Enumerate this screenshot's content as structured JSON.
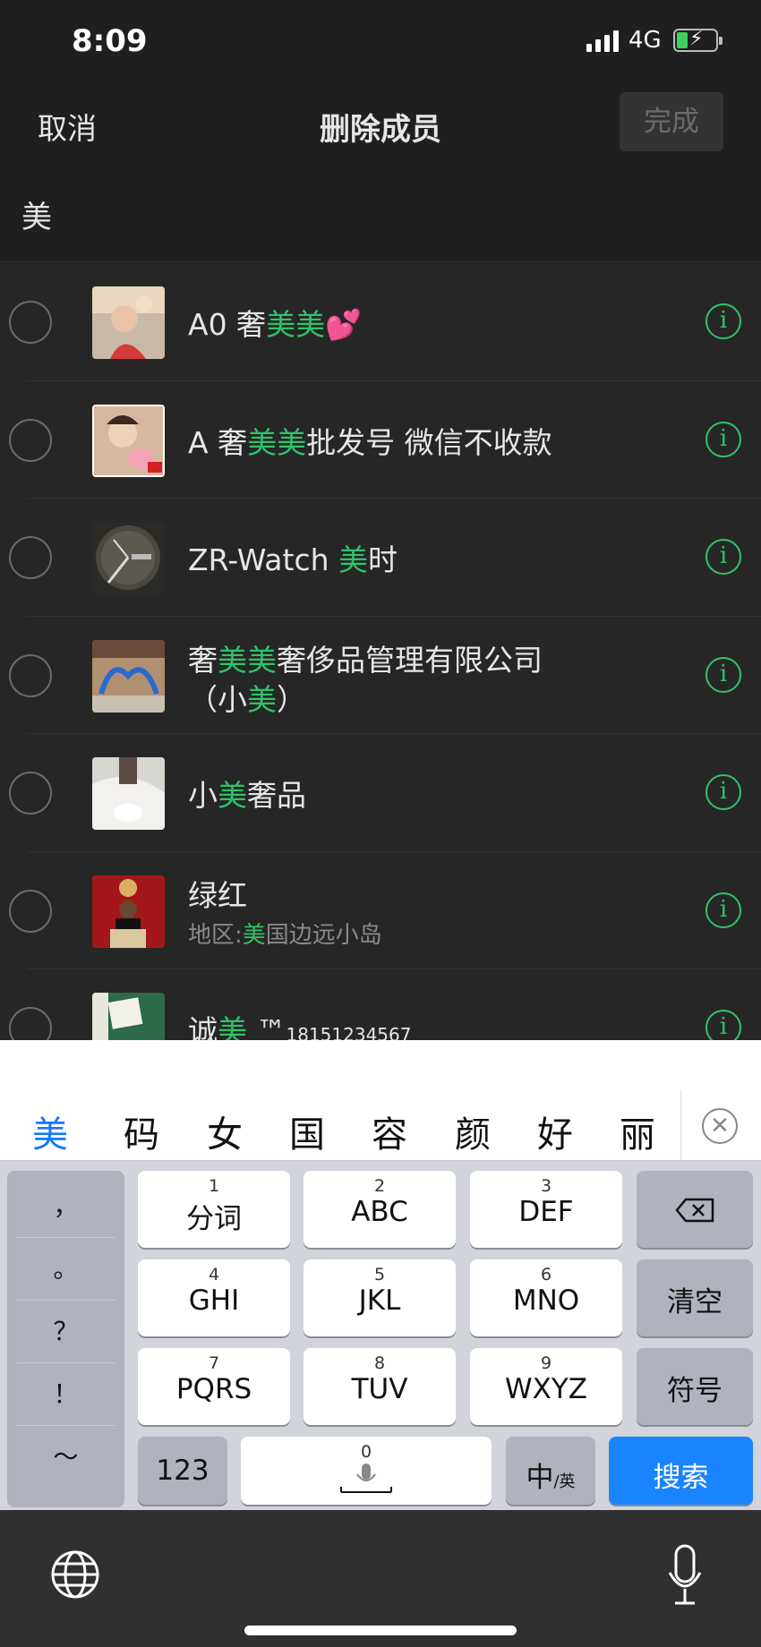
{
  "status": {
    "time": "8:09",
    "network": "4G",
    "battery_color": "#3fd15a"
  },
  "nav": {
    "cancel": "取消",
    "title": "删除成员",
    "done": "完成"
  },
  "search": {
    "query": "美"
  },
  "highlight_color": "#2fc36a",
  "contacts": [
    {
      "name_parts": [
        "A0 奢",
        "美美",
        "💕"
      ],
      "highlight": [
        false,
        true,
        false
      ],
      "sub": null
    },
    {
      "name_parts": [
        "A 奢",
        "美美",
        "批发号 微信不收款"
      ],
      "highlight": [
        false,
        true,
        false
      ],
      "sub": null
    },
    {
      "name_parts": [
        "ZR-Watch ",
        "美",
        "时"
      ],
      "highlight": [
        false,
        true,
        false
      ],
      "sub": null
    },
    {
      "name_parts": [
        "奢",
        "美美",
        "奢侈品管理有限公司"
      ],
      "highlight": [
        false,
        true,
        false
      ],
      "line2_parts": [
        "（小",
        "美",
        "）"
      ],
      "sub": null
    },
    {
      "name_parts": [
        "小",
        "美",
        "奢品"
      ],
      "highlight": [
        false,
        true,
        false
      ],
      "sub": null
    },
    {
      "name_parts": [
        "绿红"
      ],
      "highlight": [
        false
      ],
      "sub_parts": [
        "地区:",
        "美",
        "国边远小岛"
      ]
    },
    {
      "name_parts": [
        "诚",
        "美",
        " ™"
      ],
      "highlight": [
        false,
        true,
        false
      ],
      "suffix": "18151234567"
    }
  ],
  "keyboard": {
    "candidates": [
      "美",
      "码",
      "女",
      "国",
      "容",
      "颜",
      "好",
      "丽"
    ],
    "punctuation": [
      "，",
      "。",
      "？",
      "！",
      "～"
    ],
    "keys": [
      {
        "num": "1",
        "label": "分词"
      },
      {
        "num": "2",
        "label": "ABC"
      },
      {
        "num": "3",
        "label": "DEF"
      },
      {
        "num": "4",
        "label": "GHI"
      },
      {
        "num": "5",
        "label": "JKL"
      },
      {
        "num": "6",
        "label": "MNO"
      },
      {
        "num": "7",
        "label": "PQRS"
      },
      {
        "num": "8",
        "label": "TUV"
      },
      {
        "num": "9",
        "label": "WXYZ"
      }
    ],
    "clear": "清空",
    "symbols": "符号",
    "numbers": "123",
    "space_num": "0",
    "lang_main": "中",
    "lang_sub": "/英",
    "search": "搜索"
  }
}
